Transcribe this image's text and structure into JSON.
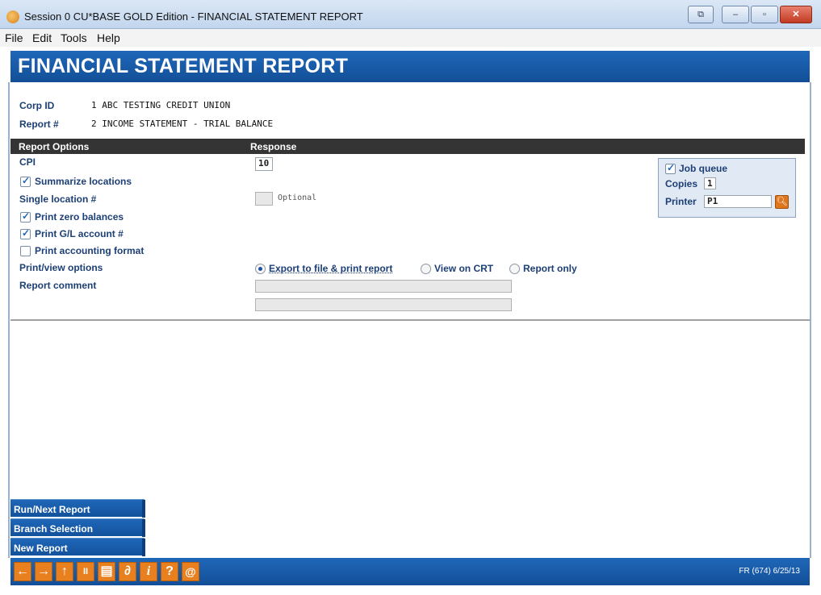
{
  "window": {
    "title": "Session 0 CU*BASE GOLD Edition - FINANCIAL STATEMENT REPORT",
    "controls": [
      "⧉",
      "–",
      "▫",
      "✕"
    ]
  },
  "menu": [
    "File",
    "Edit",
    "Tools",
    "Help"
  ],
  "banner": {
    "title": "FINANCIAL STATEMENT REPORT"
  },
  "header": {
    "corp_id_label": "Corp ID",
    "corp_id_value": "1  ABC TESTING CREDIT UNION",
    "report_label": "Report #",
    "report_value": "2  INCOME STATEMENT - TRIAL BALANCE"
  },
  "options_header": {
    "left": "Report Options",
    "right": "Response"
  },
  "options": {
    "cpi_label": "CPI",
    "cpi_value": "10",
    "summarize_locations": {
      "label": "Summarize locations",
      "checked": true
    },
    "single_location_label": "Single location #",
    "single_location_hint": "Optional",
    "print_zero_balances": {
      "label": "Print zero balances",
      "checked": true
    },
    "print_gl_account": {
      "label": "Print G/L account #",
      "checked": true
    },
    "print_accounting_format": {
      "label": "Print accounting format",
      "checked": false
    },
    "print_view_label": "Print/view options",
    "print_view_options": [
      {
        "label": "Export to file & print report",
        "selected": true
      },
      {
        "label": "View on CRT",
        "selected": false
      },
      {
        "label": "Report only",
        "selected": false
      }
    ],
    "report_comment_label": "Report comment",
    "report_comment_1": "",
    "report_comment_2": ""
  },
  "job_queue": {
    "job_queue_label": "Job queue",
    "job_queue_checked": true,
    "copies_label": "Copies",
    "copies_value": "1",
    "printer_label": "Printer",
    "printer_value": "P1",
    "lookup_icon": "magnifier-icon"
  },
  "side_buttons": [
    "Run/Next Report",
    "Branch Selection",
    "New Report"
  ],
  "toolbar": {
    "icons": [
      "back-arrow-icon",
      "forward-arrow-icon",
      "up-arrow-icon",
      "pause-icon",
      "print-icon",
      "link-icon",
      "info-icon",
      "help-icon",
      "at-icon"
    ],
    "glyphs": [
      "←",
      "→",
      "↑",
      "II",
      "▤",
      "∂",
      "i",
      "?",
      "@"
    ],
    "status": "FR (674) 6/25/13"
  },
  "colors": {
    "banner": "#1f67b8",
    "label": "#1c3f75",
    "tool_button": "#e8801f"
  }
}
